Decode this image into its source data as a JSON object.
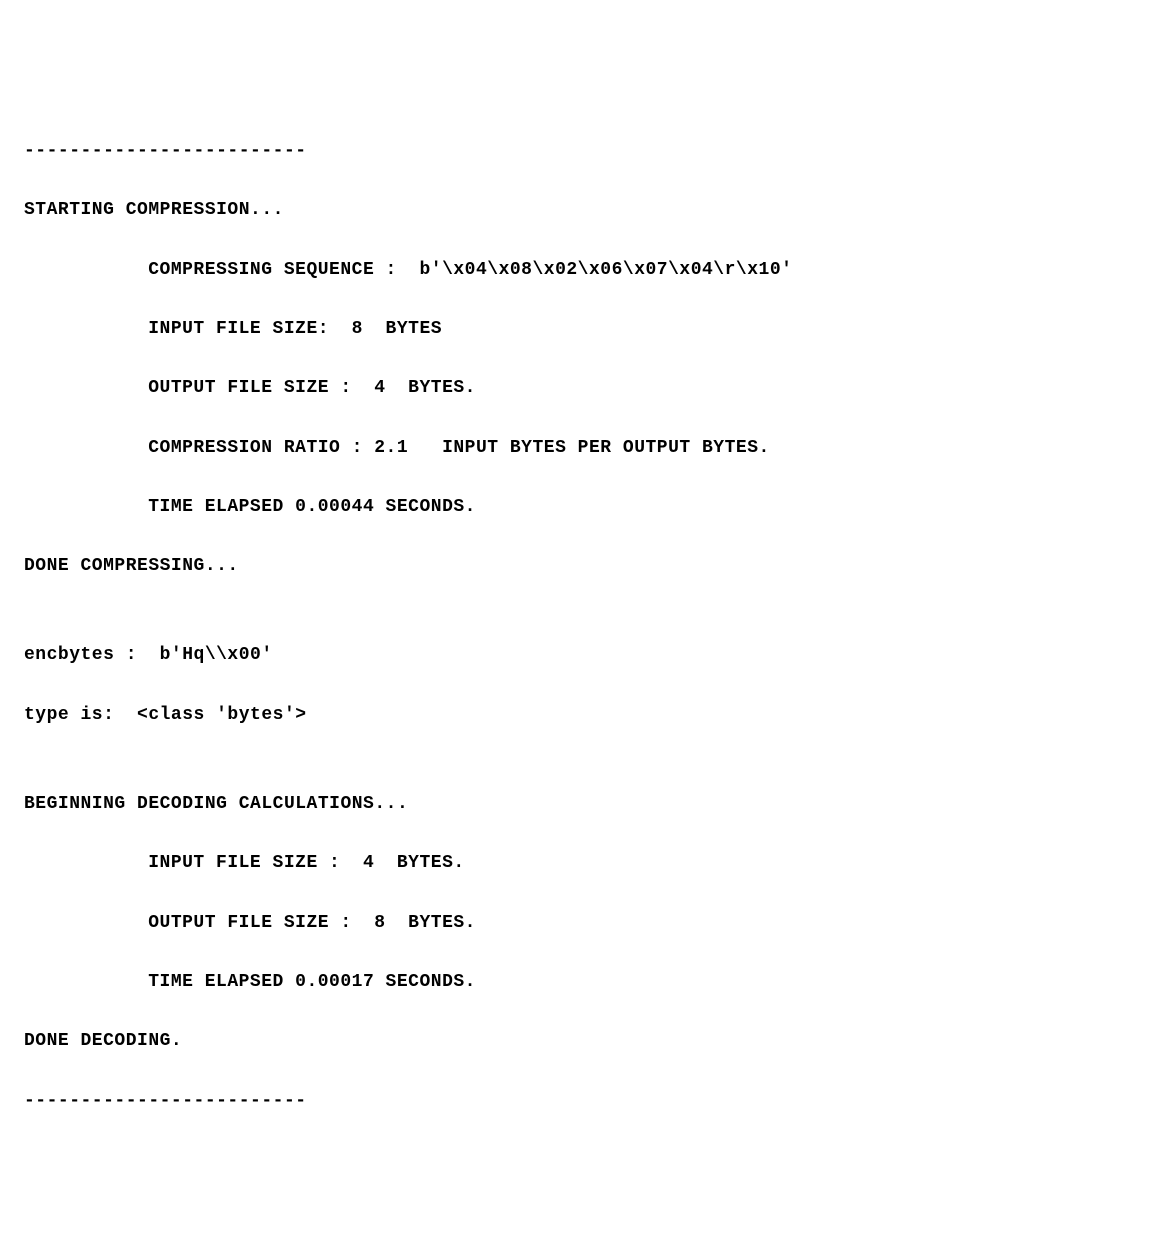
{
  "separator_top": "-------------------------",
  "starting": "STARTING COMPRESSION...",
  "compressing_sequence_label": "COMPRESSING SEQUENCE :  b'\\x04\\x08\\x02\\x06\\x07\\x04\\r\\x10'",
  "input_file_size_1": "INPUT FILE SIZE:  8  BYTES",
  "output_file_size_1": "OUTPUT FILE SIZE :  4  BYTES.",
  "compression_ratio": "COMPRESSION RATIO : 2.1   INPUT BYTES PER OUTPUT BYTES.",
  "time_elapsed_1": "TIME ELAPSED 0.00044 SECONDS.",
  "done_compressing": "DONE COMPRESSING...",
  "blank1": "",
  "encbytes": "encbytes :  b'Hq\\\\x00'",
  "type_is": "type is:  <class 'bytes'>",
  "blank2": "",
  "beginning_decoding": "BEGINNING DECODING CALCULATIONS...",
  "input_file_size_2": "INPUT FILE SIZE :  4  BYTES.",
  "output_file_size_2": "OUTPUT FILE SIZE :  8  BYTES.",
  "time_elapsed_2": "TIME ELAPSED 0.00017 SECONDS.",
  "done_decoding": "DONE DECODING.",
  "separator_bottom": "-------------------------"
}
